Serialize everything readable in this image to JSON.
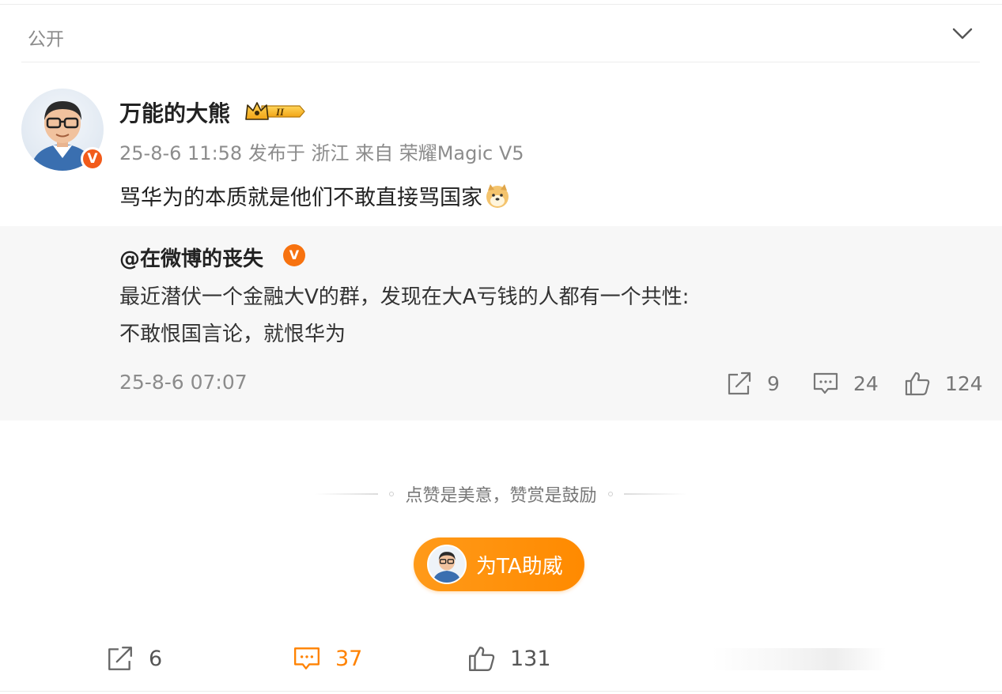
{
  "visibility": {
    "label": "公开"
  },
  "post": {
    "author_name": "万能的大熊",
    "meta": "25-8-6 11:58 发布于 浙江 来自 荣耀Magic V5",
    "text": "骂华为的本质就是他们不敢直接骂国家",
    "emoji": "doge-emoji",
    "level_badge": "II"
  },
  "repost": {
    "author": "@在微博的丧失",
    "line1": "最近潜伏一个金融大V的群，发现在大A亏钱的人都有一个共性:",
    "line2": "不敢恨国言论，就恨华为",
    "time": "25-8-6 07:07",
    "stats": {
      "share": "9",
      "comment": "24",
      "like": "124"
    }
  },
  "encourage": {
    "text": "点赞是美意，赞赏是鼓励",
    "button_label": "为TA助威"
  },
  "bottom_bar": {
    "share": "6",
    "comment": "37",
    "like": "131"
  },
  "colors": {
    "accent": "#ff8200",
    "verified": "#f25b1a",
    "card_bg": "#f7f7f7"
  }
}
